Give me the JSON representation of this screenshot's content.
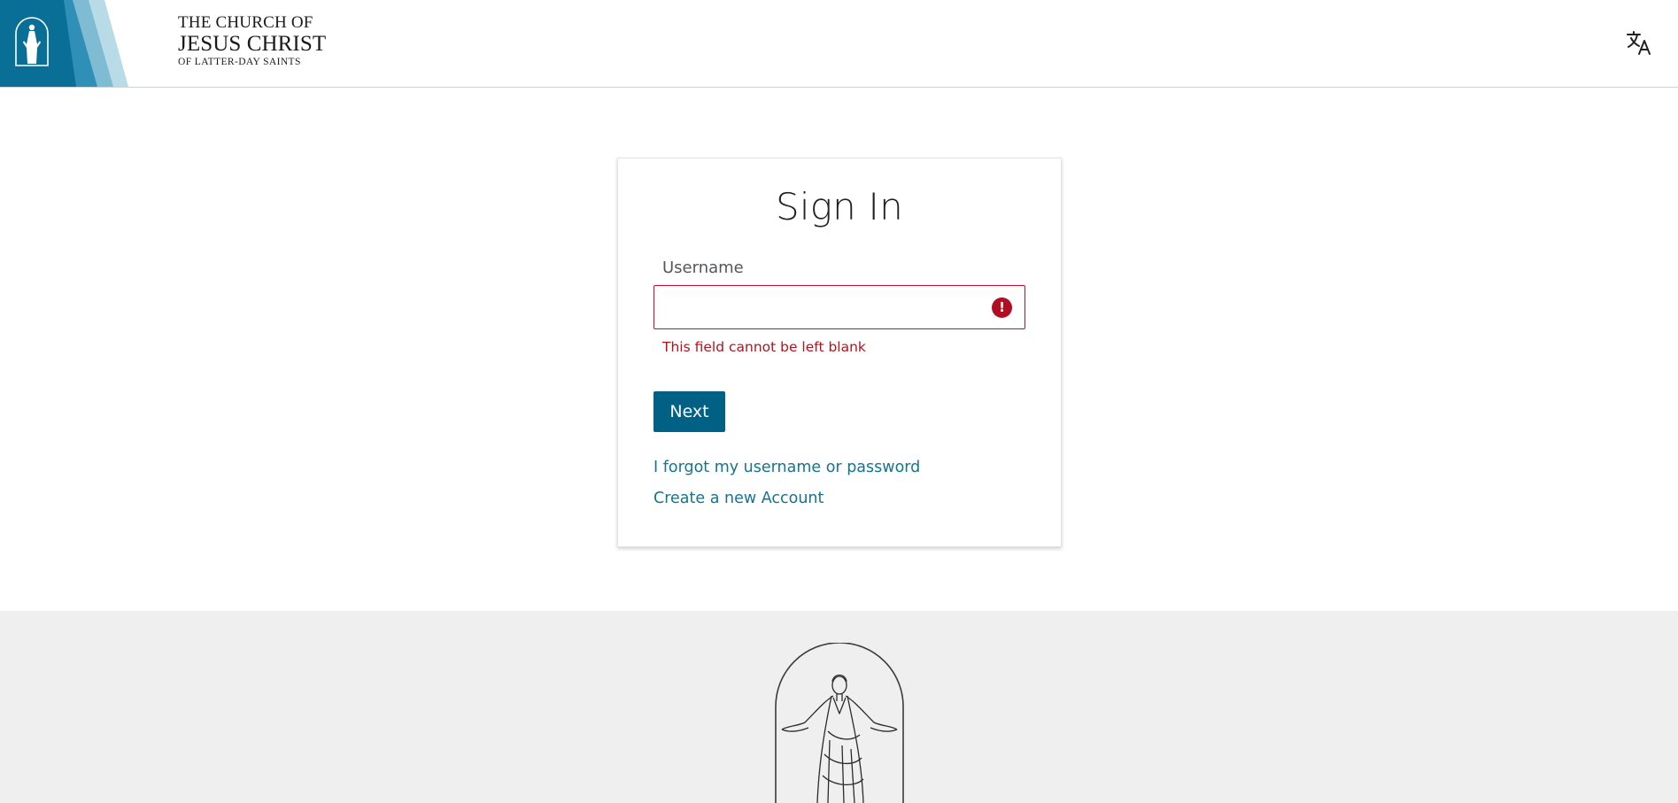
{
  "header": {
    "wordmark": {
      "line1": "THE CHURCH OF",
      "line2": "JESUS CHRIST",
      "line3": "OF LATTER-DAY SAINTS"
    },
    "language_icon": "translate-icon"
  },
  "signin": {
    "title": "Sign In",
    "username_label": "Username",
    "username_value": "",
    "error_icon": "exclamation-icon",
    "error_message": "This field cannot be left blank",
    "next_label": "Next",
    "forgot_link": "I forgot my username or password",
    "create_link": "Create a new Account"
  },
  "footer": {
    "logo_icon": "christus-statue-icon"
  },
  "colors": {
    "accent": "#006184",
    "link": "#157493",
    "error": "#b5121b",
    "footer_bg": "#eeefee"
  }
}
